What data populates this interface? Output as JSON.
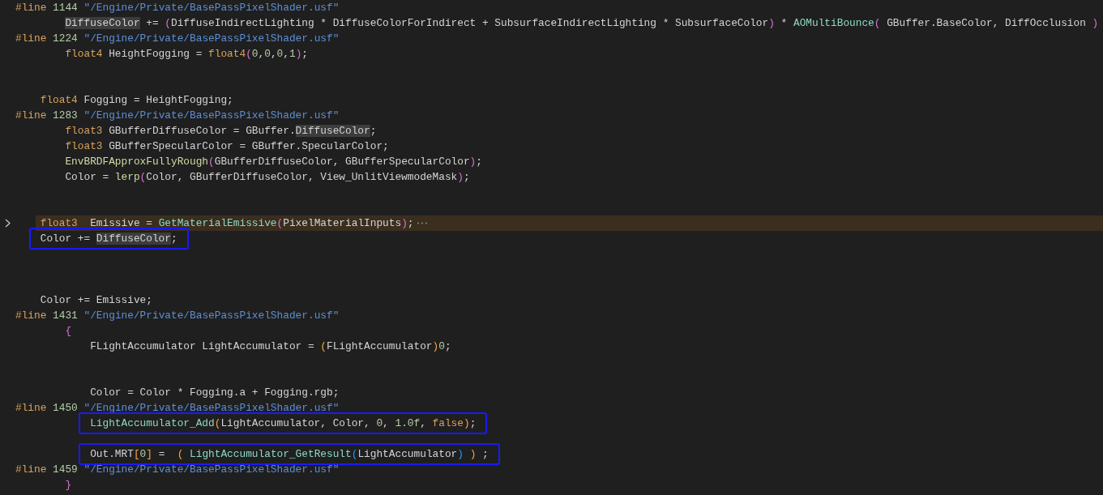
{
  "editor": {
    "lines": [
      {
        "kind": "directive",
        "folded": false,
        "boxed": false,
        "tokens": [
          {
            "kind": "dir",
            "text": "#line"
          },
          {
            "kind": "num",
            "text": " 1144"
          },
          {
            "kind": "str",
            "text": " \"/Engine/Private/BasePassPixelShader.usf\""
          }
        ]
      },
      {
        "kind": "block",
        "folded": false,
        "boxed": false,
        "tokens": [
          {
            "kind": "match",
            "text": "DiffuseColor"
          },
          {
            "kind": "plain",
            "text": " += "
          },
          {
            "kind": "p1",
            "text": "("
          },
          {
            "kind": "plain",
            "text": "DiffuseIndirectLighting * DiffuseColorForIndirect + SubsurfaceIndirectLighting * SubsurfaceColor"
          },
          {
            "kind": "p1",
            "text": ")"
          },
          {
            "kind": "plain",
            "text": " * "
          },
          {
            "kind": "fn2",
            "text": "AOMultiBounce"
          },
          {
            "kind": "p1",
            "text": "("
          },
          {
            "kind": "plain",
            "text": " GBuffer.BaseColor, DiffOcclusion "
          },
          {
            "kind": "p1",
            "text": ")"
          }
        ]
      },
      {
        "kind": "directive",
        "folded": false,
        "boxed": false,
        "tokens": [
          {
            "kind": "dir",
            "text": "#line"
          },
          {
            "kind": "num",
            "text": " 1224"
          },
          {
            "kind": "str",
            "text": " \"/Engine/Private/BasePassPixelShader.usf\""
          }
        ]
      },
      {
        "kind": "block",
        "folded": false,
        "boxed": false,
        "tokens": [
          {
            "kind": "kw",
            "text": "float4"
          },
          {
            "kind": "plain",
            "text": " HeightFogging = "
          },
          {
            "kind": "kw",
            "text": "float4"
          },
          {
            "kind": "p1",
            "text": "("
          },
          {
            "kind": "num",
            "text": "0"
          },
          {
            "kind": "plain",
            "text": ","
          },
          {
            "kind": "num",
            "text": "0"
          },
          {
            "kind": "plain",
            "text": ","
          },
          {
            "kind": "num",
            "text": "0"
          },
          {
            "kind": "plain",
            "text": ","
          },
          {
            "kind": "num",
            "text": "1"
          },
          {
            "kind": "p1",
            "text": ")"
          },
          {
            "kind": "plain",
            "text": ";"
          }
        ]
      },
      {
        "kind": "blank"
      },
      {
        "kind": "blank"
      },
      {
        "kind": "outer",
        "folded": false,
        "boxed": false,
        "tokens": [
          {
            "kind": "kw",
            "text": "float4"
          },
          {
            "kind": "plain",
            "text": " Fogging = HeightFogging;"
          }
        ]
      },
      {
        "kind": "directive",
        "folded": false,
        "boxed": false,
        "tokens": [
          {
            "kind": "dir",
            "text": "#line"
          },
          {
            "kind": "num",
            "text": " 1283"
          },
          {
            "kind": "str",
            "text": " \"/Engine/Private/BasePassPixelShader.usf\""
          }
        ]
      },
      {
        "kind": "block",
        "folded": false,
        "boxed": false,
        "tokens": [
          {
            "kind": "kw",
            "text": "float3"
          },
          {
            "kind": "plain",
            "text": " GBufferDiffuseColor = GBuffer."
          },
          {
            "kind": "match",
            "text": "DiffuseColor"
          },
          {
            "kind": "plain",
            "text": ";"
          }
        ]
      },
      {
        "kind": "block",
        "folded": false,
        "boxed": false,
        "tokens": [
          {
            "kind": "kw",
            "text": "float3"
          },
          {
            "kind": "plain",
            "text": " GBufferSpecularColor = GBuffer.SpecularColor;"
          }
        ]
      },
      {
        "kind": "block",
        "folded": false,
        "boxed": false,
        "tokens": [
          {
            "kind": "fn",
            "text": "EnvBRDFApproxFullyRough"
          },
          {
            "kind": "p1",
            "text": "("
          },
          {
            "kind": "plain",
            "text": "GBufferDiffuseColor, GBufferSpecularColor"
          },
          {
            "kind": "p1",
            "text": ")"
          },
          {
            "kind": "plain",
            "text": ";"
          }
        ]
      },
      {
        "kind": "block",
        "folded": false,
        "boxed": false,
        "tokens": [
          {
            "kind": "plain",
            "text": "Color = "
          },
          {
            "kind": "fn",
            "text": "lerp"
          },
          {
            "kind": "p1",
            "text": "("
          },
          {
            "kind": "plain",
            "text": "Color, GBufferDiffuseColor, View_UnlitViewmodeMask"
          },
          {
            "kind": "p1",
            "text": ")"
          },
          {
            "kind": "plain",
            "text": ";"
          }
        ]
      },
      {
        "kind": "blank"
      },
      {
        "kind": "blank"
      },
      {
        "kind": "outer",
        "folded": true,
        "boxed": false,
        "tokens": [
          {
            "kind": "kw",
            "text": "float3"
          },
          {
            "kind": "plain",
            "text": "  Emissive = "
          },
          {
            "kind": "fn2",
            "text": "GetMaterialEmissive"
          },
          {
            "kind": "p1",
            "text": "("
          },
          {
            "kind": "plain",
            "text": "PixelMaterialInputs"
          },
          {
            "kind": "p1",
            "text": ")"
          },
          {
            "kind": "plain",
            "text": ";"
          }
        ]
      },
      {
        "kind": "outer",
        "folded": false,
        "boxed": true,
        "tokens": [
          {
            "kind": "plain",
            "text": "Color += "
          },
          {
            "kind": "match",
            "text": "DiffuseColor"
          },
          {
            "kind": "plain",
            "text": ";"
          }
        ]
      },
      {
        "kind": "blank"
      },
      {
        "kind": "blank"
      },
      {
        "kind": "blank"
      },
      {
        "kind": "outer",
        "folded": false,
        "boxed": false,
        "tokens": [
          {
            "kind": "plain",
            "text": "Color += Emissive;"
          }
        ]
      },
      {
        "kind": "directive",
        "folded": false,
        "boxed": false,
        "tokens": [
          {
            "kind": "dir",
            "text": "#line"
          },
          {
            "kind": "num",
            "text": " 1431"
          },
          {
            "kind": "str",
            "text": " \"/Engine/Private/BasePassPixelShader.usf\""
          }
        ]
      },
      {
        "kind": "block",
        "folded": false,
        "boxed": false,
        "tokens": [
          {
            "kind": "p1",
            "text": "{"
          }
        ]
      },
      {
        "kind": "inner",
        "folded": false,
        "boxed": false,
        "tokens": [
          {
            "kind": "plain",
            "text": "FLightAccumulator LightAccumulator = "
          },
          {
            "kind": "p2",
            "text": "("
          },
          {
            "kind": "plain",
            "text": "FLightAccumulator"
          },
          {
            "kind": "p2",
            "text": ")"
          },
          {
            "kind": "num",
            "text": "0"
          },
          {
            "kind": "plain",
            "text": ";"
          }
        ]
      },
      {
        "kind": "blank"
      },
      {
        "kind": "blank"
      },
      {
        "kind": "inner",
        "folded": false,
        "boxed": false,
        "tokens": [
          {
            "kind": "plain",
            "text": "Color = Color * Fogging.a + Fogging.rgb;"
          }
        ]
      },
      {
        "kind": "directive",
        "folded": false,
        "boxed": false,
        "tokens": [
          {
            "kind": "dir",
            "text": "#line"
          },
          {
            "kind": "num",
            "text": " 1450"
          },
          {
            "kind": "str",
            "text": " \"/Engine/Private/BasePassPixelShader.usf\""
          }
        ]
      },
      {
        "kind": "inner",
        "folded": false,
        "boxed": true,
        "tokens": [
          {
            "kind": "fn2",
            "text": "LightAccumulator_Add"
          },
          {
            "kind": "p2",
            "text": "("
          },
          {
            "kind": "plain",
            "text": "LightAccumulator, Color, "
          },
          {
            "kind": "num",
            "text": "0"
          },
          {
            "kind": "plain",
            "text": ", "
          },
          {
            "kind": "num",
            "text": "1.0f"
          },
          {
            "kind": "plain",
            "text": ", "
          },
          {
            "kind": "kw",
            "text": "false"
          },
          {
            "kind": "p2",
            "text": ")"
          },
          {
            "kind": "plain",
            "text": ";"
          }
        ]
      },
      {
        "kind": "blank"
      },
      {
        "kind": "inner",
        "folded": false,
        "boxed": true,
        "tokens": [
          {
            "kind": "plain",
            "text": "Out.MRT"
          },
          {
            "kind": "p2",
            "text": "["
          },
          {
            "kind": "num",
            "text": "0"
          },
          {
            "kind": "p2",
            "text": "]"
          },
          {
            "kind": "plain",
            "text": " =  "
          },
          {
            "kind": "p2",
            "text": "( "
          },
          {
            "kind": "fn2",
            "text": "LightAccumulator_GetResult"
          },
          {
            "kind": "p3",
            "text": "("
          },
          {
            "kind": "plain",
            "text": "LightAccumulator"
          },
          {
            "kind": "p3",
            "text": ") "
          },
          {
            "kind": "p2",
            "text": ")"
          },
          {
            "kind": "plain",
            "text": " ;"
          }
        ]
      },
      {
        "kind": "directive",
        "folded": false,
        "boxed": false,
        "tokens": [
          {
            "kind": "dir",
            "text": "#line"
          },
          {
            "kind": "num",
            "text": " 1459"
          },
          {
            "kind": "str",
            "text": " \"/Engine/Private/BasePassPixelShader.usf\""
          }
        ]
      },
      {
        "kind": "block",
        "folded": false,
        "boxed": false,
        "tokens": [
          {
            "kind": "p1",
            "text": "}"
          }
        ]
      }
    ]
  }
}
